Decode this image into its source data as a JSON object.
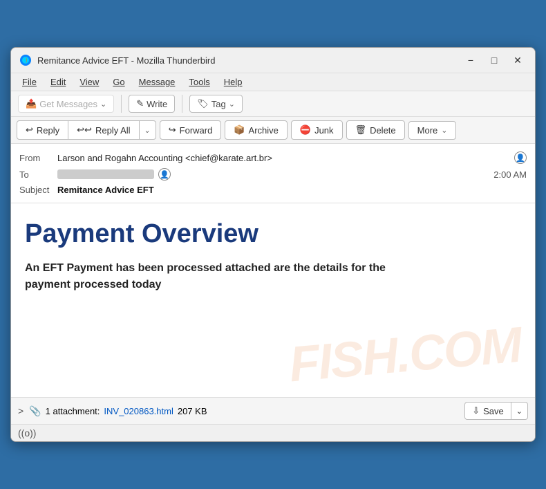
{
  "window": {
    "title": "Remitance Advice EFT - Mozilla Thunderbird",
    "icon": "thunderbird"
  },
  "menu": {
    "items": [
      "File",
      "Edit",
      "View",
      "Go",
      "Message",
      "Tools",
      "Help"
    ]
  },
  "toolbar": {
    "get_messages_label": "Get Messages",
    "write_label": "Write",
    "tag_label": "Tag"
  },
  "action_bar": {
    "reply_label": "Reply",
    "reply_all_label": "Reply All",
    "forward_label": "Forward",
    "archive_label": "Archive",
    "junk_label": "Junk",
    "delete_label": "Delete",
    "more_label": "More"
  },
  "email": {
    "from_label": "From",
    "from_value": "Larson and Rogahn Accounting <chief@karate.art.br>",
    "to_label": "To",
    "time": "2:00 AM",
    "subject_label": "Subject",
    "subject_value": "Remitance Advice EFT",
    "heading": "Payment Overview",
    "body": "An EFT Payment has been processed attached are the details for the payment processed today"
  },
  "attachment": {
    "expand_label": ">",
    "count_label": "1 attachment:",
    "filename": "INV_020863.html",
    "size": "207 KB",
    "save_label": "Save"
  },
  "status_bar": {
    "signal_label": "((o))"
  },
  "watermark": {
    "text": "FISH.COM"
  }
}
